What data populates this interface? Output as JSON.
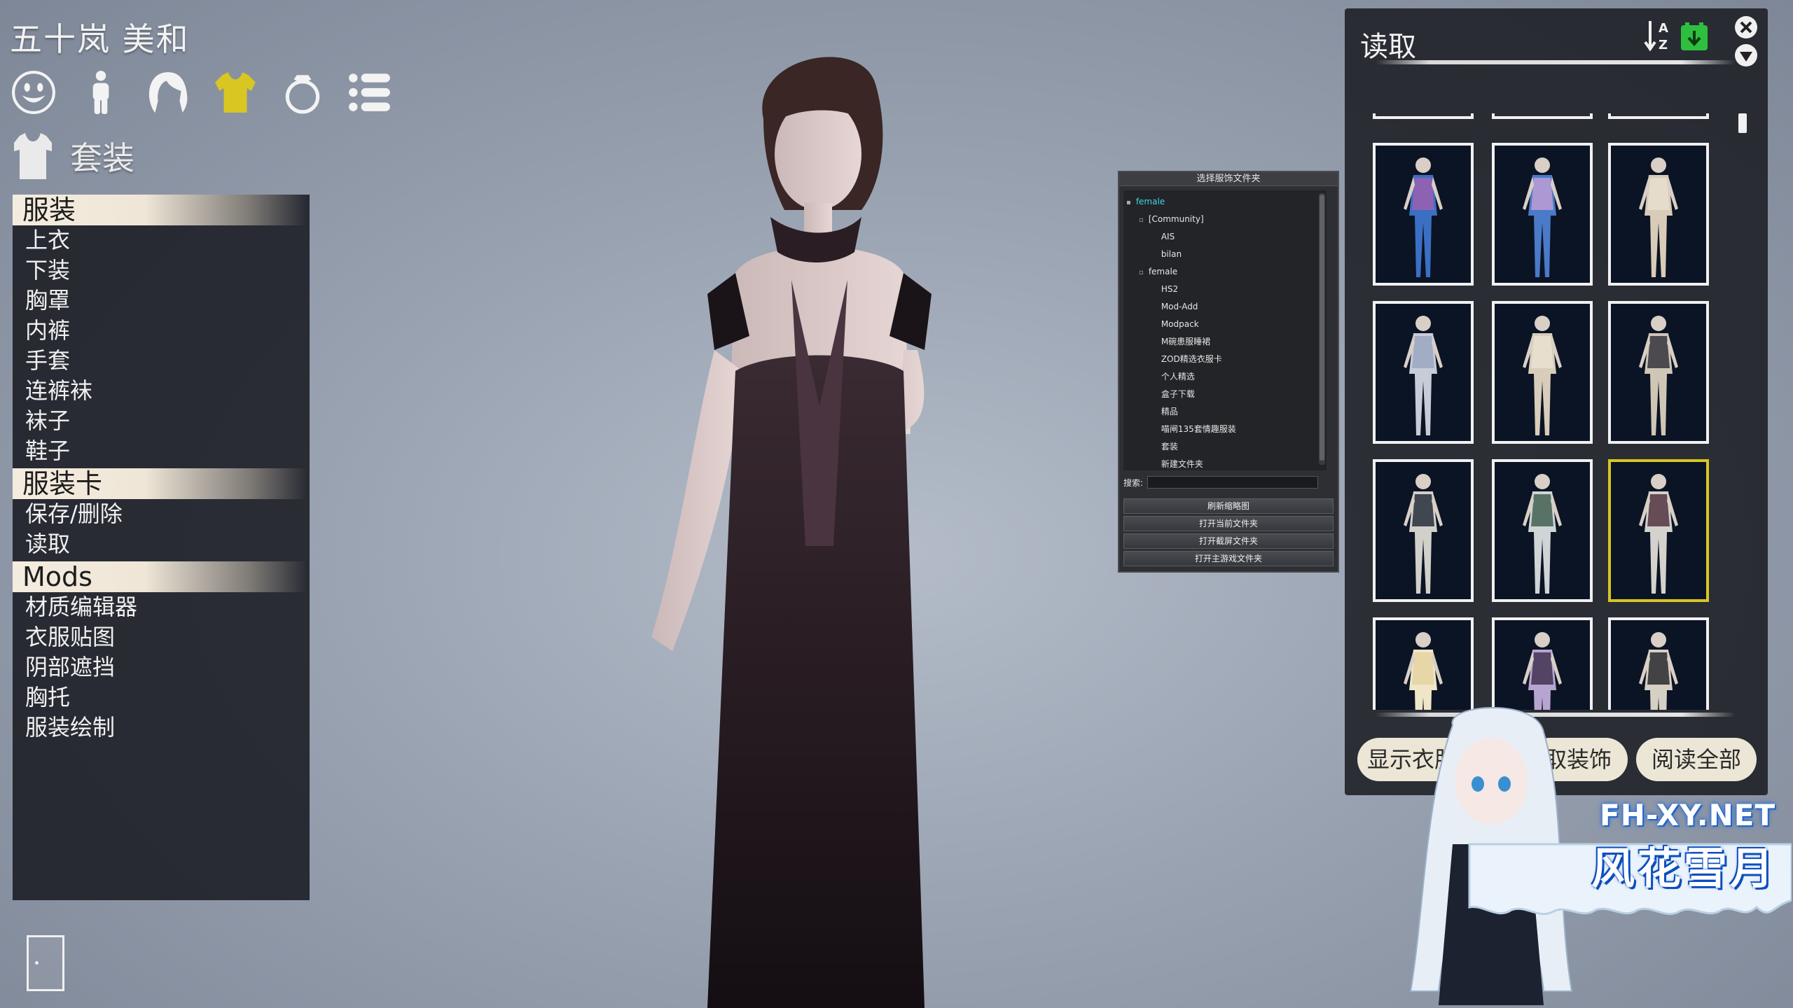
{
  "character": {
    "name": "五十岚 美和"
  },
  "categories": [
    {
      "icon": "face-icon",
      "active": false
    },
    {
      "icon": "body-icon",
      "active": false
    },
    {
      "icon": "hair-icon",
      "active": false
    },
    {
      "icon": "clothes-icon",
      "active": true
    },
    {
      "icon": "accessory-ring-icon",
      "active": false
    },
    {
      "icon": "list-icon",
      "active": false
    }
  ],
  "section": {
    "icon": "shirt-icon",
    "title": "套装"
  },
  "menu": {
    "clothing_header": "服装",
    "clothing_items": [
      "上衣",
      "下装",
      "胸罩",
      "内裤",
      "手套",
      "连裤袜",
      "袜子",
      "鞋子"
    ],
    "card_header": "服装卡",
    "card_items": [
      "保存/删除",
      "读取"
    ],
    "mods_header": "Mods",
    "mods_items": [
      "材质编辑器",
      "衣服贴图",
      "阴部遮挡",
      "胸托",
      "服装绘制"
    ]
  },
  "folder_panel": {
    "title": "选择服饰文件夹",
    "tree": [
      {
        "label": "female",
        "level": 0,
        "toggle": "▪",
        "selected": true
      },
      {
        "label": "[Community]",
        "level": 1,
        "toggle": "▫",
        "selected": false
      },
      {
        "label": "AIS",
        "level": 2,
        "toggle": "",
        "selected": false
      },
      {
        "label": "bilan",
        "level": 2,
        "toggle": "",
        "selected": false
      },
      {
        "label": "female",
        "level": 1,
        "toggle": "▫",
        "selected": false
      },
      {
        "label": "HS2",
        "level": 2,
        "toggle": "",
        "selected": false
      },
      {
        "label": "Mod-Add",
        "level": 2,
        "toggle": "",
        "selected": false
      },
      {
        "label": "Modpack",
        "level": 2,
        "toggle": "",
        "selected": false
      },
      {
        "label": "M碗患服睡裙",
        "level": 2,
        "toggle": "",
        "selected": false
      },
      {
        "label": "ZOD精选衣服卡",
        "level": 2,
        "toggle": "",
        "selected": false
      },
      {
        "label": "个人精选",
        "level": 2,
        "toggle": "",
        "selected": false
      },
      {
        "label": "盒子下载",
        "level": 2,
        "toggle": "",
        "selected": false
      },
      {
        "label": "精品",
        "level": 2,
        "toggle": "",
        "selected": false
      },
      {
        "label": "喵闸135套情趣服装",
        "level": 2,
        "toggle": "",
        "selected": false
      },
      {
        "label": "套装",
        "level": 2,
        "toggle": "",
        "selected": false
      },
      {
        "label": "新建文件夹",
        "level": 2,
        "toggle": "",
        "selected": false
      }
    ],
    "search_label": "搜索:",
    "search_value": "",
    "buttons": [
      "刷新缩略图",
      "打开当前文件夹",
      "打开截屏文件夹",
      "打开主游戏文件夹"
    ]
  },
  "load_panel": {
    "title": "读取",
    "sort_icon": "sort-az-icon",
    "save_icon": "download-green-icon",
    "thumbnails": [
      {
        "color": "#3b6fc4",
        "accent": "#a25fae",
        "selected": false
      },
      {
        "color": "#4a7ac8",
        "accent": "#c4a0d6",
        "selected": false
      },
      {
        "color": "#d8cbb8",
        "accent": "#e9e0d0",
        "selected": false
      },
      {
        "color": "#c8ccd8",
        "accent": "#9aa4c0",
        "selected": false
      },
      {
        "color": "#d8cdbb",
        "accent": "#ece2d2",
        "selected": false
      },
      {
        "color": "#cfc6b6",
        "accent": "#2a2a34",
        "selected": false
      },
      {
        "color": "#d2d0ca",
        "accent": "#1d2432",
        "selected": false
      },
      {
        "color": "#cfd4d6",
        "accent": "#3a5a4a",
        "selected": false
      },
      {
        "color": "#d4d2cc",
        "accent": "#4a2a3a",
        "selected": true
      },
      {
        "color": "#efe6c8",
        "accent": "#e3d2a0",
        "selected": false
      },
      {
        "color": "#b8a4d0",
        "accent": "#3a2a4a",
        "selected": false
      },
      {
        "color": "#d6cfc4",
        "accent": "#1e1e26",
        "selected": false
      }
    ],
    "buttons": {
      "show_clothes": "显示衣服",
      "accessories": "取装饰",
      "read_all": "阅读全部"
    }
  },
  "watermark": {
    "site": "FH-XY.NET",
    "name": "风花雪月"
  },
  "colors": {
    "accent_yellow": "#d8c622",
    "folder_selected": "#3fd6e8",
    "panel_bg": "#1c1e24",
    "button_bg": "#ece6d6"
  }
}
